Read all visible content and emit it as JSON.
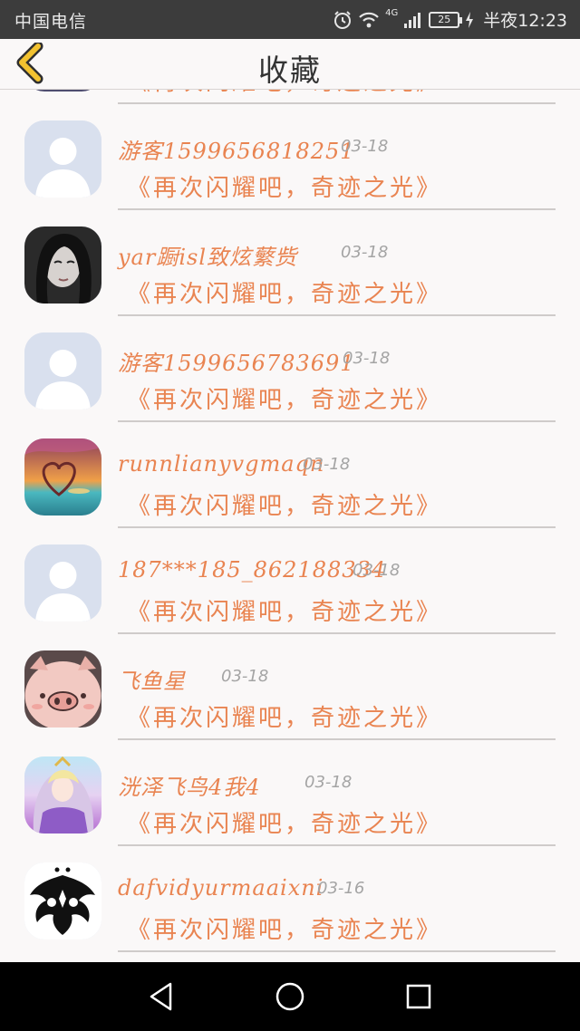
{
  "status_bar": {
    "carrier": "中国电信",
    "network": "4G",
    "battery": "25",
    "time": "半夜12:23"
  },
  "header": {
    "title": "收藏"
  },
  "top_partial": {
    "song": "《再次闪耀吧，奇迹之光》"
  },
  "items": [
    {
      "name": "游客1599656818251",
      "date": "03-18",
      "song": "《再次闪耀吧，奇迹之光》",
      "avatar": "default-avatar"
    },
    {
      "name": "yar蹰isl致炫蘩赀",
      "date": "03-18",
      "song": "《再次闪耀吧，奇迹之光》",
      "avatar": "photo-avatar"
    },
    {
      "name": "游客1599656783691",
      "date": "03-18",
      "song": "《再次闪耀吧，奇迹之光》",
      "avatar": "default-avatar"
    },
    {
      "name": "runnlianyvgmaqn",
      "date": "03-18",
      "song": "《再次闪耀吧，奇迹之光》",
      "avatar": "heart-sunset-avatar"
    },
    {
      "name": "187***185_862188334",
      "date": "03-18",
      "song": "《再次闪耀吧，奇迹之光》",
      "avatar": "default-avatar"
    },
    {
      "name": "飞鱼星",
      "date": "03-18",
      "song": "《再次闪耀吧，奇迹之光》",
      "avatar": "pig-avatar"
    },
    {
      "name": "洸泽飞鸟4我4",
      "date": "03-18",
      "song": "《再次闪耀吧，奇迹之光》",
      "avatar": "anime-avatar"
    },
    {
      "name": "dafvidyurmaaixni",
      "date": "03-16",
      "song": "《再次闪耀吧，奇迹之光》",
      "avatar": "tribal-avatar"
    }
  ],
  "system_nav": {
    "back": "back-triangle-icon",
    "home": "home-circle-icon",
    "recents": "recents-square-icon"
  },
  "colors": {
    "accent": "#e98451",
    "date": "#a4a4a4",
    "status_bar": "#3c3c3c",
    "back_arrow": "#f2c230"
  }
}
